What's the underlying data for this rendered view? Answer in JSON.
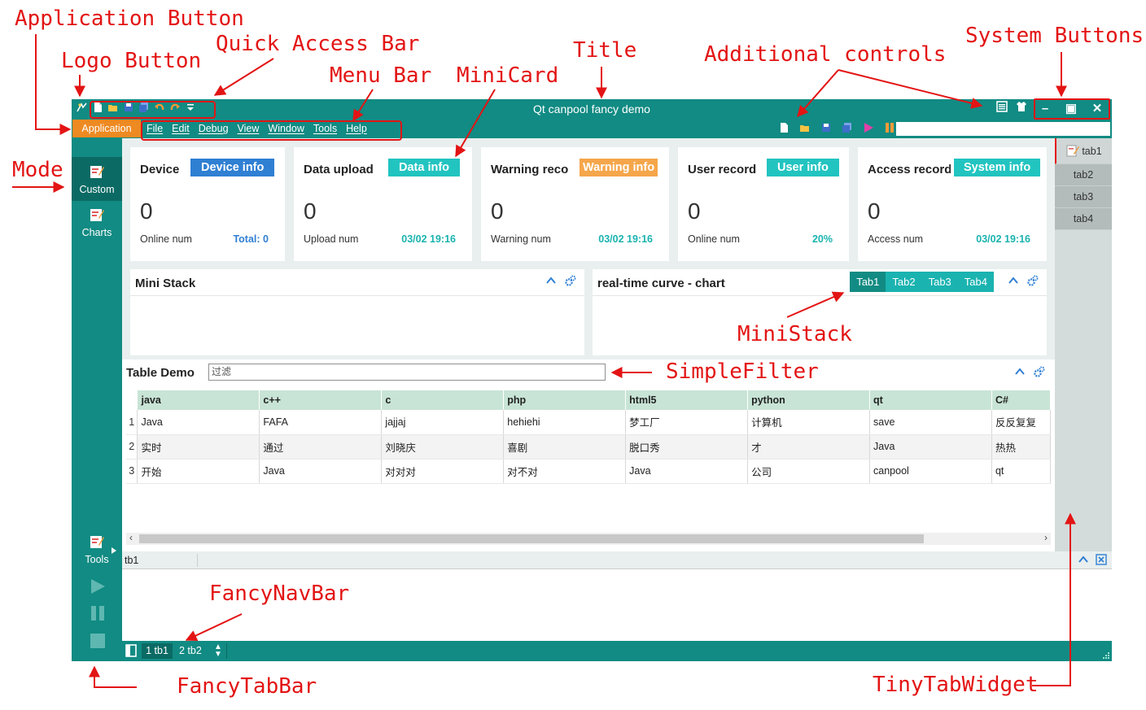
{
  "window": {
    "title": "Qt canpool fancy demo"
  },
  "menubar": {
    "app_button": "Application",
    "menus": [
      "File",
      "Edit",
      "Debug",
      "View",
      "Window",
      "Tools",
      "Help"
    ]
  },
  "modes": {
    "items": [
      "Custom",
      "Charts"
    ],
    "tools_label": "Tools"
  },
  "cards": [
    {
      "title": "Device",
      "badge": "Device info",
      "badge_color": "#2f7fd3",
      "num": "0",
      "label": "Online num",
      "value": "Total: 0",
      "value_color": "#2f7fd3"
    },
    {
      "title": "Data upload",
      "badge": "Data info",
      "badge_color": "#22c4c0",
      "num": "0",
      "label": "Upload num",
      "value": "03/02 19:16",
      "value_color": "#1ab3b0"
    },
    {
      "title": "Warning reco",
      "badge": "Warning info",
      "badge_color": "#f5a64a",
      "num": "0",
      "label": "Warning num",
      "value": "03/02 19:16",
      "value_color": "#1ab3b0"
    },
    {
      "title": "User record",
      "badge": "User info",
      "badge_color": "#22c4c0",
      "num": "0",
      "label": "Online num",
      "value": "20%",
      "value_color": "#1ab3b0"
    },
    {
      "title": "Access record",
      "badge": "System info",
      "badge_color": "#22c4c0",
      "num": "0",
      "label": "Access num",
      "value": "03/02 19:16",
      "value_color": "#1ab3b0"
    }
  ],
  "mini_stack": {
    "title": "Mini Stack"
  },
  "chart_stack": {
    "title": "real-time curve - chart",
    "tabs": [
      "Tab1",
      "Tab2",
      "Tab3",
      "Tab4"
    ]
  },
  "table": {
    "title": "Table Demo",
    "filter_placeholder": "过滤",
    "columns": [
      "java",
      "c++",
      "c",
      "php",
      "html5",
      "python",
      "qt",
      "C#"
    ],
    "rows": [
      {
        "n": "1",
        "cells": [
          "Java",
          "FAFA",
          "jajjaj",
          "hehiehi",
          "梦工厂",
          "计算机",
          "save",
          "反反复复"
        ]
      },
      {
        "n": "2",
        "cells": [
          "实时",
          "通过",
          "刘晓庆",
          "喜剧",
          "脱口秀",
          "才",
          "Java",
          "热热"
        ]
      },
      {
        "n": "3",
        "cells": [
          "开始",
          "Java",
          "对对对",
          "对不对",
          "Java",
          "公司",
          "canpool",
          "qt"
        ]
      }
    ]
  },
  "tiny_tabs": [
    "tab1",
    "tab2",
    "tab3",
    "tab4"
  ],
  "dock": {
    "tab": "tb1"
  },
  "tabbar": {
    "tab1": "1 tb1",
    "tab2": "2 tb2"
  },
  "colors": {
    "teal": "#118b83",
    "accent": "#ee8a22",
    "annotation": "#e31414"
  },
  "annotations": {
    "application_button": "Application Button",
    "quick_access_bar": "Quick Access Bar",
    "logo_button": "Logo Button",
    "menu_bar": "Menu Bar",
    "mini_card": "MiniCard",
    "title": "Title",
    "additional_controls": "Additional controls",
    "system_buttons": "System Buttons",
    "mode": "Mode",
    "mini_stack": "MiniStack",
    "simple_filter": "SimpleFilter",
    "fancy_nav_bar": "FancyNavBar",
    "fancy_tab_bar": "FancyTabBar",
    "tiny_tab_widget": "TinyTabWidget"
  }
}
